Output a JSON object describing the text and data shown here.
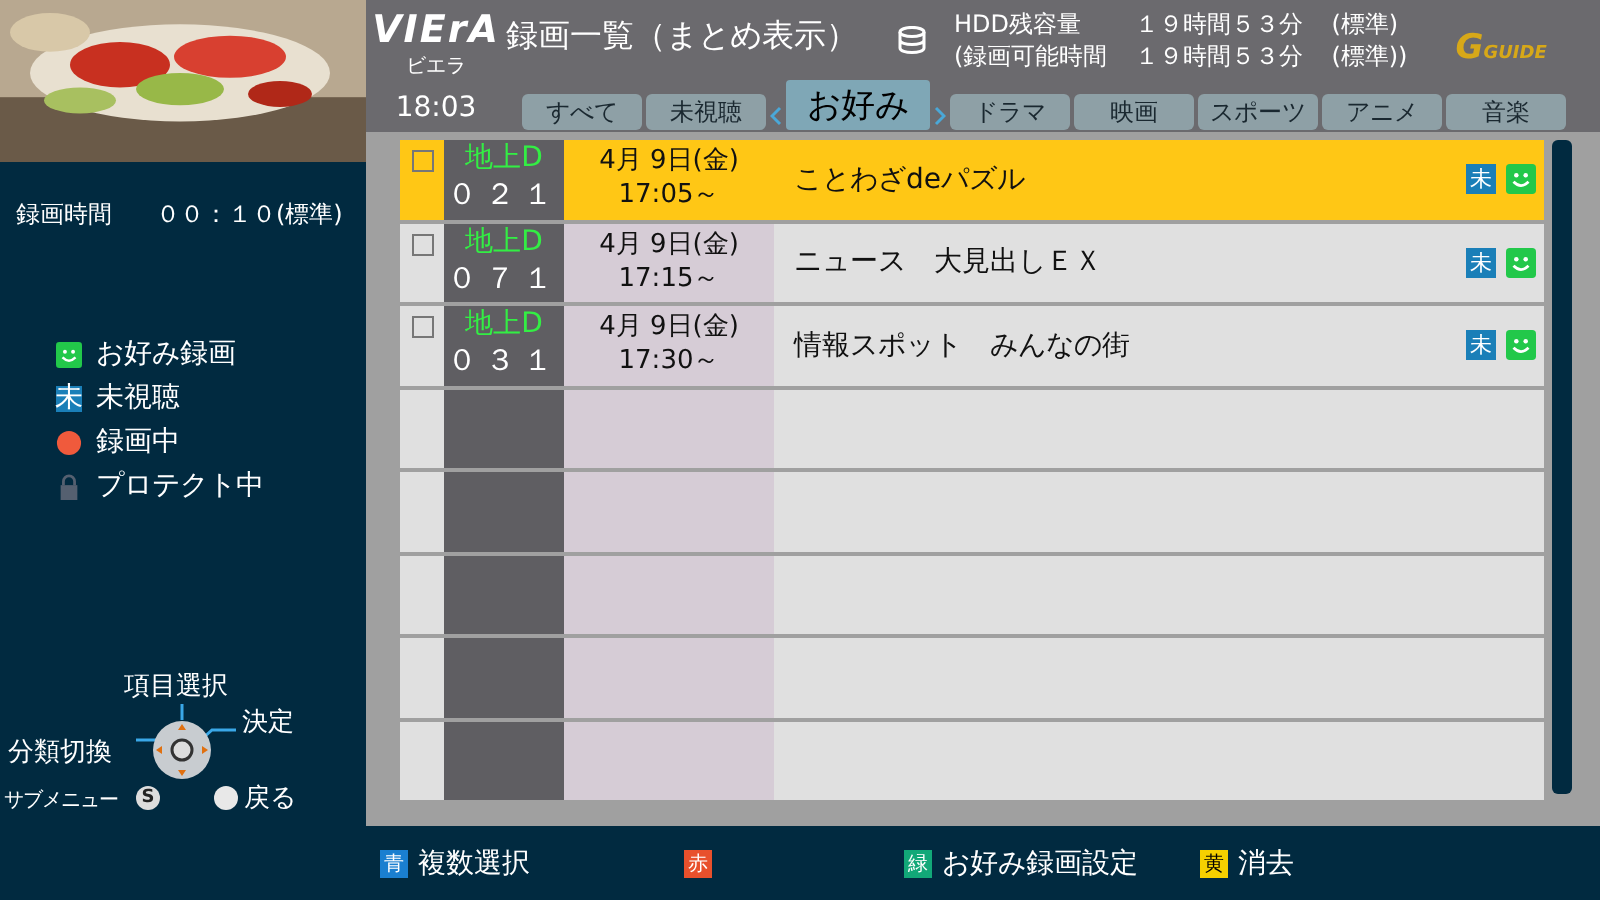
{
  "side": {
    "recording_time_label": "録画時間",
    "recording_time_value": "００：１０(標準)",
    "legend": [
      {
        "kind": "favorite",
        "label": "お好み録画"
      },
      {
        "kind": "unwatched",
        "badge": "未",
        "label": "未視聴"
      },
      {
        "kind": "recording",
        "label": "録画中"
      },
      {
        "kind": "protect",
        "label": "プロテクト中"
      }
    ],
    "remote": {
      "up": "項目選択",
      "enter": "決定",
      "left": "分類切換",
      "submenu": "サブメニュー",
      "submenu_key": "S",
      "back": "戻る"
    }
  },
  "header": {
    "logo": "VIErA",
    "logo_sub": "ビエラ",
    "title": "録画一覧（まとめ表示）",
    "clock": "18:03",
    "hdd_label": "HDD残容量",
    "hdd_value": "１９時間５３分",
    "hdd_mode": "(標準)",
    "time_label": "(録画可能時間",
    "time_value": "１９時間５３分",
    "time_mode": "(標準))",
    "guide_mark": "G",
    "guide_word": "GUIDE"
  },
  "tabs": [
    {
      "label": "すべて",
      "selected": false
    },
    {
      "label": "未視聴",
      "selected": false
    },
    {
      "label": "お好み",
      "selected": true
    },
    {
      "label": "ドラマ",
      "selected": false
    },
    {
      "label": "映画",
      "selected": false
    },
    {
      "label": "スポーツ",
      "selected": false
    },
    {
      "label": "アニメ",
      "selected": false
    },
    {
      "label": "音楽",
      "selected": false
    }
  ],
  "rows": [
    {
      "kind": "program",
      "selected": true,
      "checked": false,
      "channel_type": "地上D",
      "channel": "０２１",
      "date": "4月 9日(金)",
      "time": "17:05～",
      "title": "ことわざdeパズル",
      "unwatched_badge": "未",
      "favorite": true
    },
    {
      "kind": "program",
      "selected": false,
      "checked": false,
      "channel_type": "地上D",
      "channel": "０７１",
      "date": "4月 9日(金)",
      "time": "17:15～",
      "title": "ニュース　大見出しＥＸ",
      "unwatched_badge": "未",
      "favorite": true
    },
    {
      "kind": "program",
      "selected": false,
      "checked": false,
      "channel_type": "地上D",
      "channel": "０３１",
      "date": "4月 9日(金)",
      "time": "17:30～",
      "title": "情報スポット　みんなの街",
      "unwatched_badge": "未",
      "favorite": true
    },
    {
      "kind": "empty"
    },
    {
      "kind": "empty"
    },
    {
      "kind": "empty"
    },
    {
      "kind": "empty"
    },
    {
      "kind": "empty"
    }
  ],
  "footer": [
    {
      "key": "青",
      "color": "#1a7fd0",
      "label": "複数選択"
    },
    {
      "key": "赤",
      "color": "#e8502c"
    },
    {
      "key": "緑",
      "color": "#12a878",
      "label": "お好み録画設定"
    },
    {
      "key": "黄",
      "color": "#f5d000",
      "label": "消去"
    }
  ]
}
